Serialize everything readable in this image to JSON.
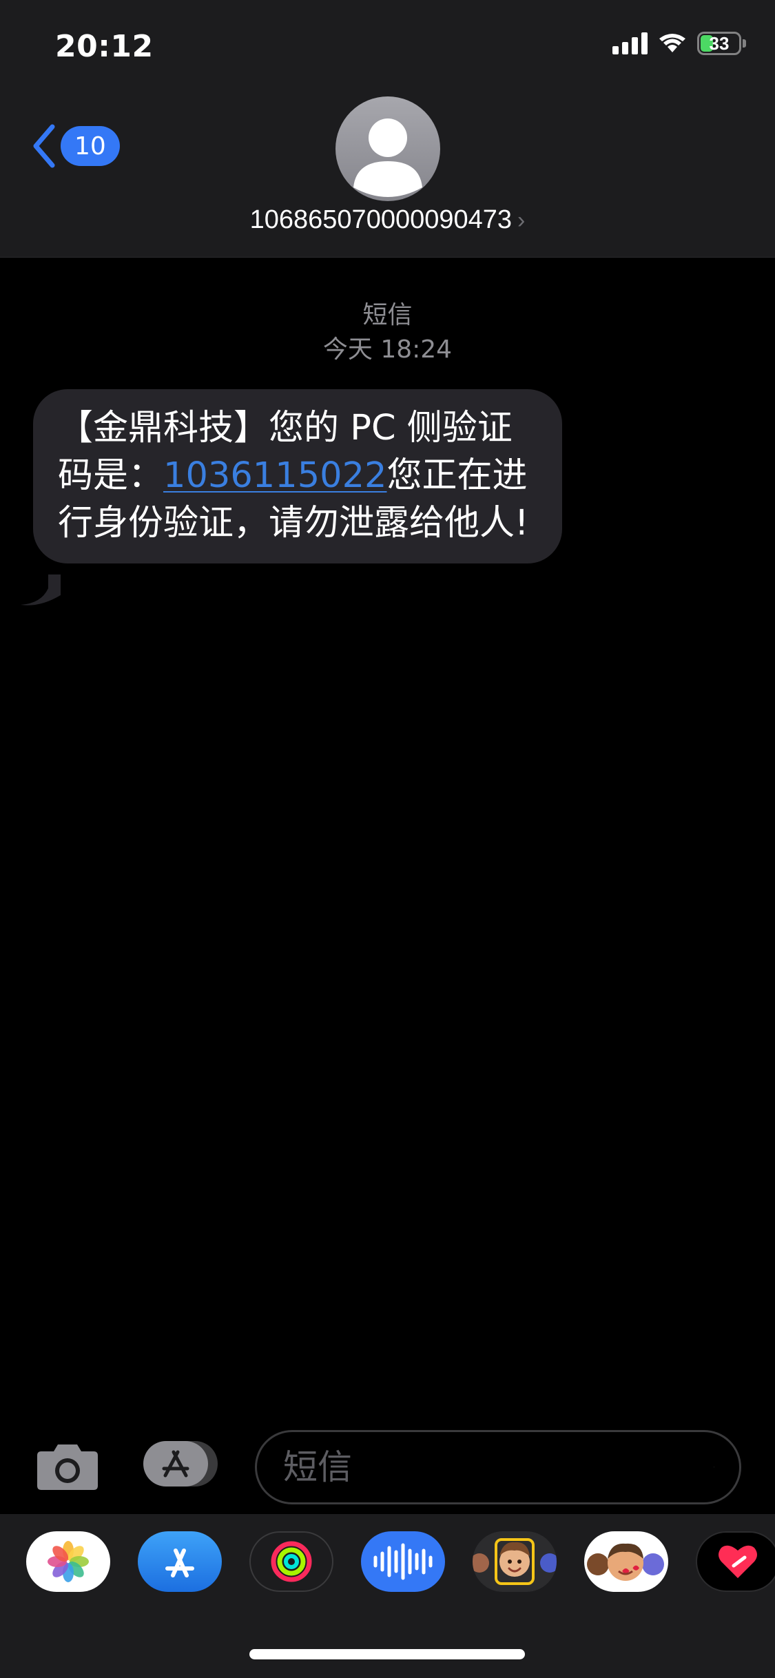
{
  "status_bar": {
    "time": "20:12",
    "battery_level": "33"
  },
  "header": {
    "back_count": "10",
    "contact_number": "106865070000090473",
    "contact_chevron": "›"
  },
  "conversation": {
    "service": "短信",
    "timestamp": "今天 18:24",
    "message": {
      "text_before": "【金鼎科技】您的 PC 侧验证码是：",
      "code": "1036115022",
      "text_after": "您正在进行身份验证，请勿泄露给他人!"
    }
  },
  "input_bar": {
    "placeholder": "短信"
  },
  "colors": {
    "accent": "#3478f6",
    "bubble": "#26252a",
    "header_bg": "#1c1c1e",
    "battery": "#4cd964"
  },
  "app_drawer": {
    "apps": [
      "photos-app-icon",
      "app-store-icon",
      "activity-icon",
      "audio-message-icon",
      "memoji-icon",
      "memoji-stickers-icon",
      "digital-touch-icon"
    ]
  }
}
